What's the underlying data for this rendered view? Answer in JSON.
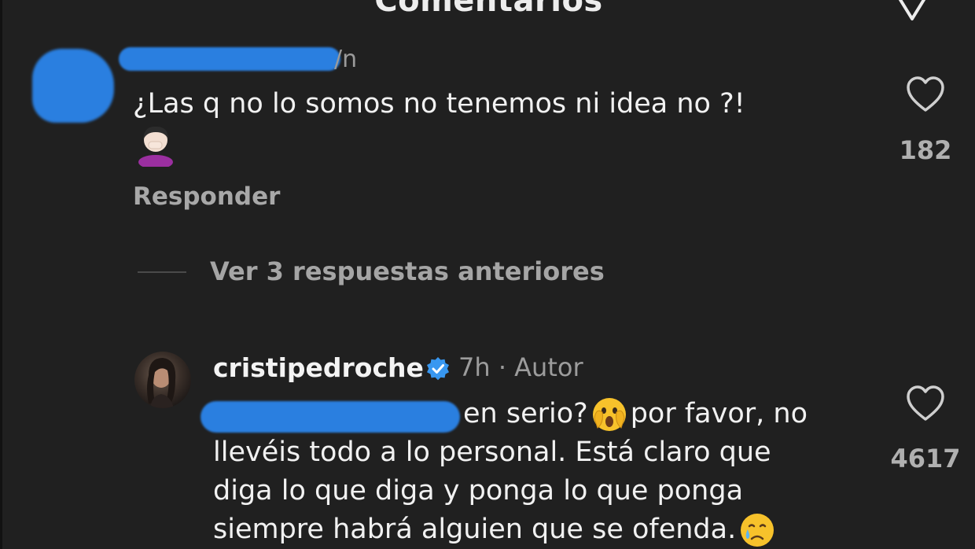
{
  "header": {
    "title": "Comentarios",
    "close_icon": "chevron-down-icon"
  },
  "comment": {
    "time": "/n",
    "text": "¿Las q no lo somos no tenemos ni idea no ?!",
    "emoji_icon": "woman-facepalming-emoji",
    "reply_label": "Responder",
    "likes": "182"
  },
  "thread": {
    "view_replies_label": "Ver 3 respuestas anteriores"
  },
  "reply": {
    "author": "cristipedroche",
    "verified_icon": "verified-badge-icon",
    "time": "7h",
    "separator": "·",
    "role": "Autor",
    "line1_a": "en serio?",
    "line1_b": "por favor, no",
    "line2": "llevéis todo a lo personal. Está claro que",
    "line3": "diga lo que diga y ponga lo que ponga",
    "line4": "siempre habrá alguien que se ofenda.",
    "emoji_1": "face-screaming-emoji",
    "emoji_2": "crying-face-emoji",
    "likes": "4617"
  },
  "colors": {
    "background": "#202020",
    "text": "#f1f1f1",
    "muted": "#a5a5a5",
    "redaction": "#2a7fe0",
    "verified": "#3897f0"
  }
}
